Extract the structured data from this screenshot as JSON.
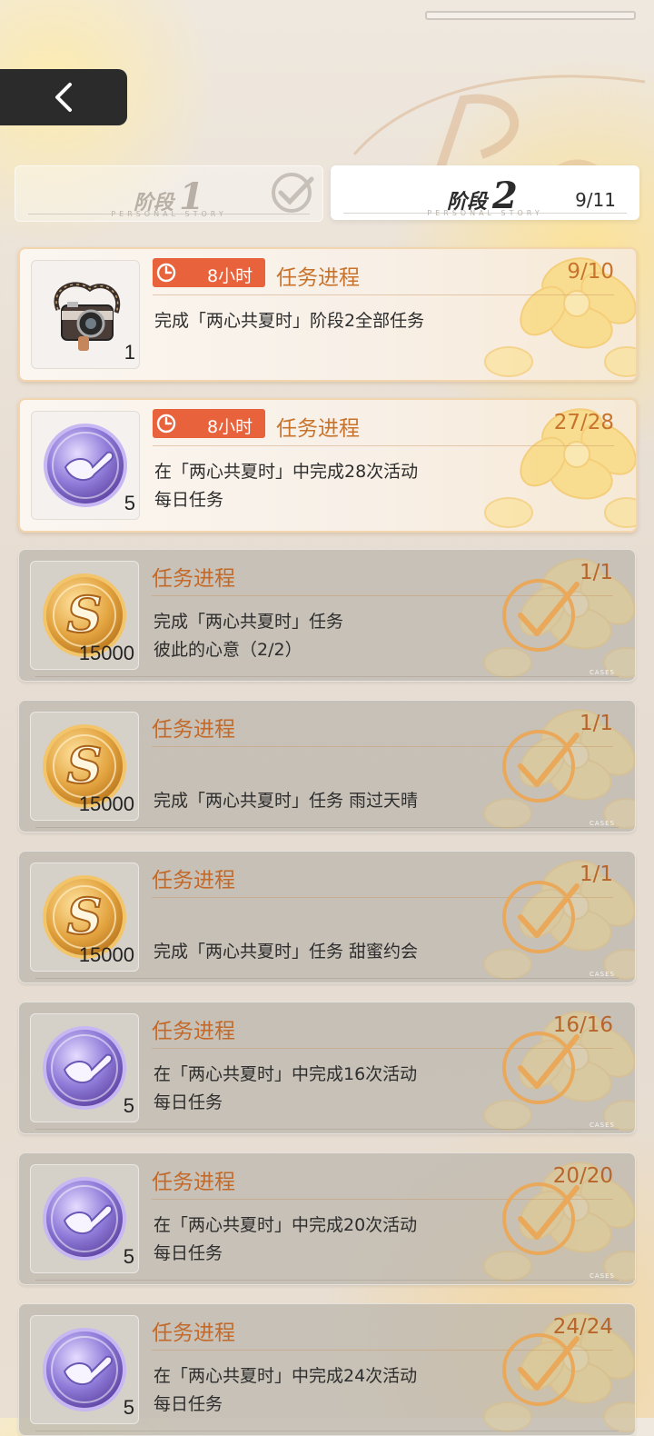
{
  "nav": {
    "back_icon": "chevron-left-icon"
  },
  "tabs": [
    {
      "word": "阶段",
      "num": "1",
      "subtitle": "PERSONAL STORY",
      "completed": true
    },
    {
      "word": "阶段",
      "num": "2",
      "subtitle": "PERSONAL STORY",
      "count": "9/11",
      "selected": true
    }
  ],
  "tasks": [
    {
      "state": "active",
      "reward": "camera",
      "qty": "1",
      "timer": "8小时",
      "title": "任务进程",
      "progress": "9/10",
      "desc1": "完成「两心共夏时」阶段2全部任务",
      "desc2": ""
    },
    {
      "state": "active",
      "reward": "purple-token",
      "qty": "5",
      "timer": "8小时",
      "title": "任务进程",
      "progress": "27/28",
      "desc1": "在「两心共夏时」中完成28次活动",
      "desc2": "每日任务"
    },
    {
      "state": "done",
      "reward": "gold-coin",
      "qty": "15000",
      "title": "任务进程",
      "progress": "1/1",
      "desc1": "完成「两心共夏时」任务",
      "desc2": "彼此的心意（2/2）",
      "tag": "CASES"
    },
    {
      "state": "done",
      "reward": "gold-coin",
      "qty": "15000",
      "title": "任务进程",
      "progress": "1/1",
      "desc1": "",
      "desc2": "完成「两心共夏时」任务 雨过天晴",
      "tag": "CASES"
    },
    {
      "state": "done",
      "reward": "gold-coin",
      "qty": "15000",
      "title": "任务进程",
      "progress": "1/1",
      "desc1": "",
      "desc2": "完成「两心共夏时」任务 甜蜜约会",
      "tag": "CASES"
    },
    {
      "state": "done",
      "reward": "purple-token",
      "qty": "5",
      "title": "任务进程",
      "progress": "16/16",
      "desc1": "在「两心共夏时」中完成16次活动",
      "desc2": "每日任务",
      "tag": "CASES"
    },
    {
      "state": "done",
      "reward": "purple-token",
      "qty": "5",
      "title": "任务进程",
      "progress": "20/20",
      "desc1": "在「两心共夏时」中完成20次活动",
      "desc2": "每日任务",
      "tag": "CASES"
    },
    {
      "state": "done",
      "reward": "purple-token",
      "qty": "5",
      "title": "任务进程",
      "progress": "24/24",
      "desc1": "在「两心共夏时」中完成24次活动",
      "desc2": "每日任务",
      "tag": ""
    }
  ],
  "colors": {
    "accent": "#c8732c",
    "timer_bg": "#e8623c",
    "check": "#e9a85a"
  }
}
